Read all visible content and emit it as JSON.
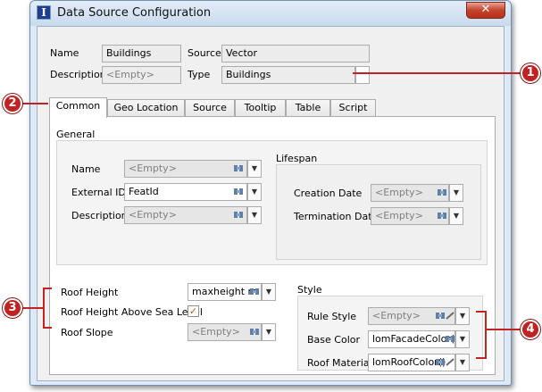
{
  "window": {
    "title": "Data Source Configuration",
    "app_icon": "I",
    "close_glyph": "✕"
  },
  "header": {
    "name_label": "Name",
    "name_value": "Buildings",
    "source_label": "Source",
    "source_value": "Vector",
    "description_label": "Description",
    "description_value": "<Empty>",
    "type_label": "Type",
    "type_value": "Buildings"
  },
  "tabs": [
    {
      "label": "Common",
      "active": true
    },
    {
      "label": "Geo Location"
    },
    {
      "label": "Source"
    },
    {
      "label": "Tooltip"
    },
    {
      "label": "Table"
    },
    {
      "label": "Script"
    }
  ],
  "general": {
    "title": "General",
    "name_label": "Name",
    "name_value": "<Empty>",
    "external_id_label": "External ID",
    "external_id_value": "FeatId",
    "description_label": "Description",
    "description_value": "<Empty>"
  },
  "lifespan": {
    "title": "Lifespan",
    "creation_label": "Creation Date",
    "creation_value": "<Empty>",
    "termination_label": "Termination Date",
    "termination_value": "<Empty>"
  },
  "roof": {
    "height_label": "Roof Height",
    "height_value": "maxheight  m",
    "above_sea_label": "Roof Height Above Sea Level",
    "above_sea_checked": true,
    "check_glyph": "✓",
    "slope_label": "Roof Slope",
    "slope_value": "<Empty>"
  },
  "style": {
    "title": "Style",
    "rule_label": "Rule Style",
    "rule_value": "<Empty>",
    "base_label": "Base Color",
    "base_value": "lomFacadeColor()",
    "material_label": "Roof Material",
    "material_value": "lomRoofColor()"
  },
  "glyphs": {
    "dropdown": "▼"
  },
  "callouts": [
    "1",
    "2",
    "3",
    "4"
  ],
  "colors": {
    "callout": "#c32222",
    "title_bar": "#c9daee",
    "close_button": "#c4432b",
    "check": "#c06000"
  }
}
